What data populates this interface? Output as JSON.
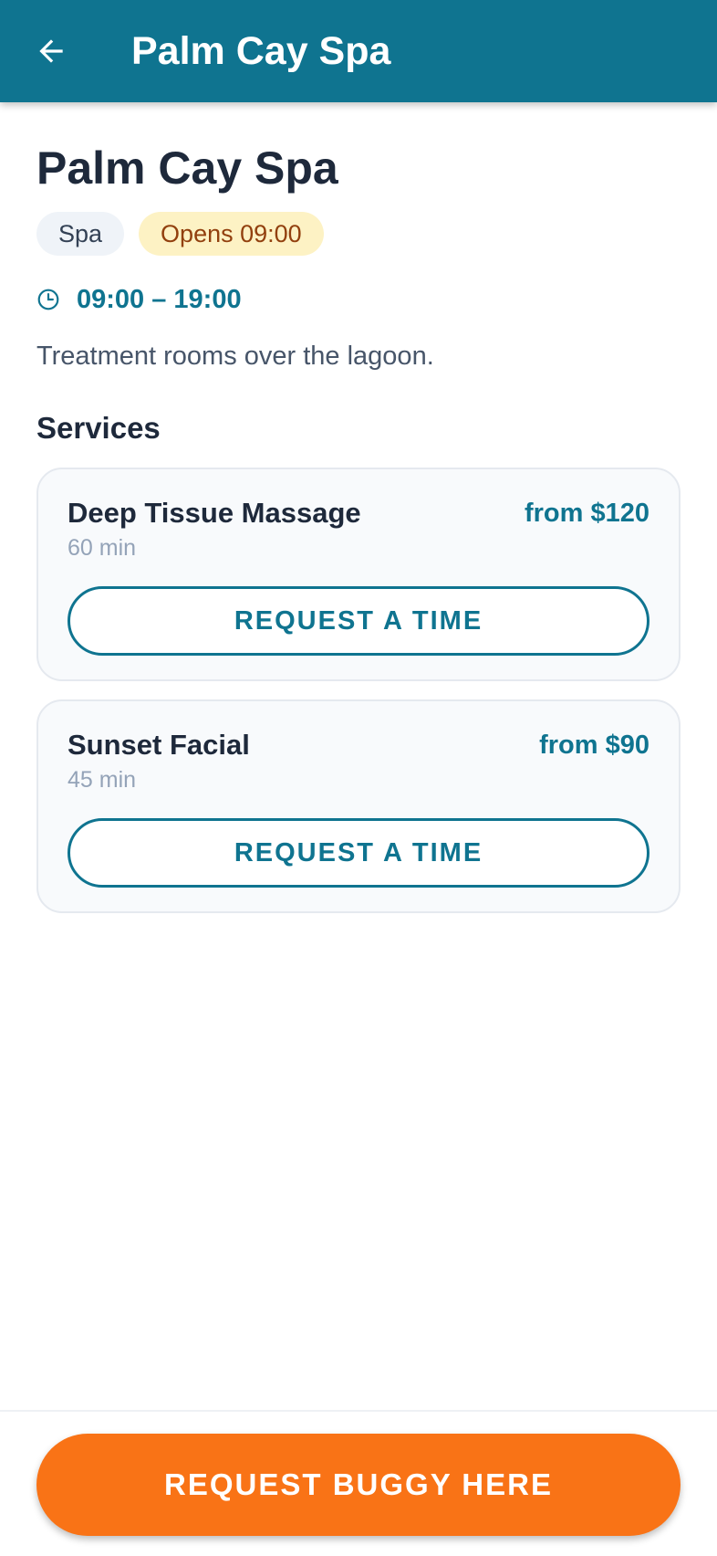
{
  "app_bar": {
    "title": "Palm Cay Spa",
    "back_icon": "arrow-left-icon"
  },
  "venue": {
    "name": "Palm Cay Spa",
    "category": "Spa",
    "status": "Opens 09:00",
    "hours_icon": "clock-icon",
    "hours": "09:00 – 19:00",
    "description": "Treatment rooms over the lagoon."
  },
  "services": {
    "title": "Services",
    "items": [
      {
        "name": "Deep Tissue Massage",
        "duration": "60 min",
        "price": "from $120",
        "button_label": "REQUEST A TIME"
      },
      {
        "name": "Sunset Facial",
        "duration": "45 min",
        "price": "from $90",
        "button_label": "REQUEST A TIME"
      }
    ]
  },
  "bottom": {
    "buggy_label": "REQUEST BUGGY HERE"
  },
  "colors": {
    "primary": "#0f7490",
    "accent": "#f97316",
    "status_bg": "#fdf2c4",
    "status_text": "#92400e"
  }
}
